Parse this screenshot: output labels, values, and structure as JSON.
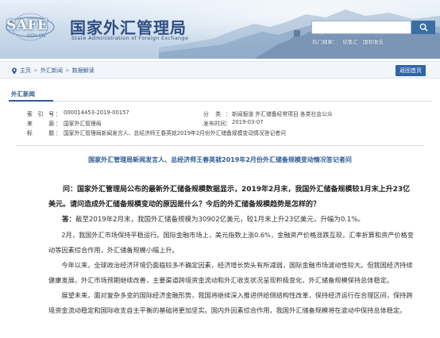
{
  "header": {
    "logo_text": "SAFE",
    "logo_domain": "GOV.CN",
    "title_cn": "国家外汇管理局",
    "title_en": "State Administration of Foreign Exchange",
    "search_placeholder": "",
    "hot_label": "热门搜索：",
    "hot_items": [
      "结售汇",
      "国际收支"
    ]
  },
  "breadcrumb": {
    "items": [
      "主页",
      "外汇新闻",
      "数据解读"
    ],
    "separator": ">",
    "back_label": "返回首页"
  },
  "section": {
    "title": "外汇新闻"
  },
  "meta": {
    "index_label": "索引号",
    "index_value": "000014453-2019-00157",
    "category_label": "分类",
    "category_value": "新闻报道 外汇储备经常项目 各类社会公众",
    "source_label": "来源",
    "source_value": "国家外汇管理局",
    "date_label": "发布时间",
    "date_value": "2019-03-07",
    "title_label": "标题",
    "title_value": "国家外汇管理局新闻发言人、总经济师王春英就2019年2月份外汇储备规模变动情况答记者问"
  },
  "article": {
    "title": "国家外汇管理局新闻发言人、总经济师王春英就2019年2月份外汇储备规模变动情况答记者问",
    "question": "问：国家外汇管理局公布的最新外汇储备规模数据显示，2019年2月末，我国外汇储备规模较1月末上升23亿美元。请问造成外汇储备规模变动的原因是什么？今后的外汇储备规模趋势是怎样的？",
    "answer_label": "答：",
    "answer_first": "截至2019年2月末，我国外汇储备规模为30902亿美元，较1月末上升23亿美元，升幅为0.1%。",
    "paragraphs": [
      "2月，我国外汇市场保持平稳运行。国际金融市场上，美元指数上涨0.6%，金融资产价格涨跌互现，汇率折算和资产价格变动等因素综合作用，外汇储备规模小幅上升。",
      "今年以来，全球政治经济环境仍面临较多不确定因素，经济增长势头有所减弱，国际金融市场波动性较大。但我国经济持续健康发展，外汇市场预期继续改善，主要渠道跨境资金流动和外汇收支状况呈现积极变化，外汇储备规模保持总体稳定。",
      "展望未来，面对复杂多变的国际经济金融形势，我国将继续深入推进供给侧结构性改革，保持经济运行在合理区间，保持跨境资金流动稳定和国际收支自主平衡的基础将更加坚实。国内外因素综合作用，我国外汇储备规模将在波动中保持总体稳定。"
    ]
  },
  "colors": {
    "brand_blue": "#2e5c96",
    "button_blue": "#2f64a6"
  }
}
